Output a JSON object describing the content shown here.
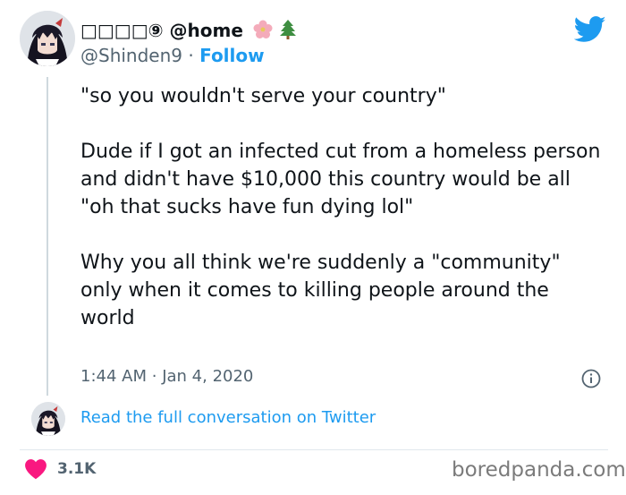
{
  "header": {
    "display_name_prefix": "□□□□⑨",
    "display_name": "@home",
    "name_emoji_1": "cherry-blossom",
    "name_emoji_2": "evergreen-tree",
    "handle": "@Shinden9",
    "separator": "·",
    "follow_label": "Follow"
  },
  "tweet": {
    "paragraphs": [
      "\"so you wouldn't serve your country\"",
      "Dude if I got an infected cut from a homeless person and didn't have $10,000 this country would be all \"oh that sucks have fun dying lol\"",
      "Why you all think we're suddenly a \"community\" only when it comes to killing people around the world"
    ],
    "time": "1:44 AM",
    "date_separator": "·",
    "date": "Jan 4, 2020"
  },
  "conversation": {
    "link_label": "Read the full conversation on Twitter"
  },
  "engagement": {
    "likes": "3.1K"
  },
  "watermark": "boredpanda.com",
  "colors": {
    "accent": "#1d9bf0",
    "like": "#f91880",
    "muted": "#536471"
  },
  "icons": {
    "brand": "twitter-bird-icon",
    "info": "info-icon",
    "like": "heart-icon"
  }
}
